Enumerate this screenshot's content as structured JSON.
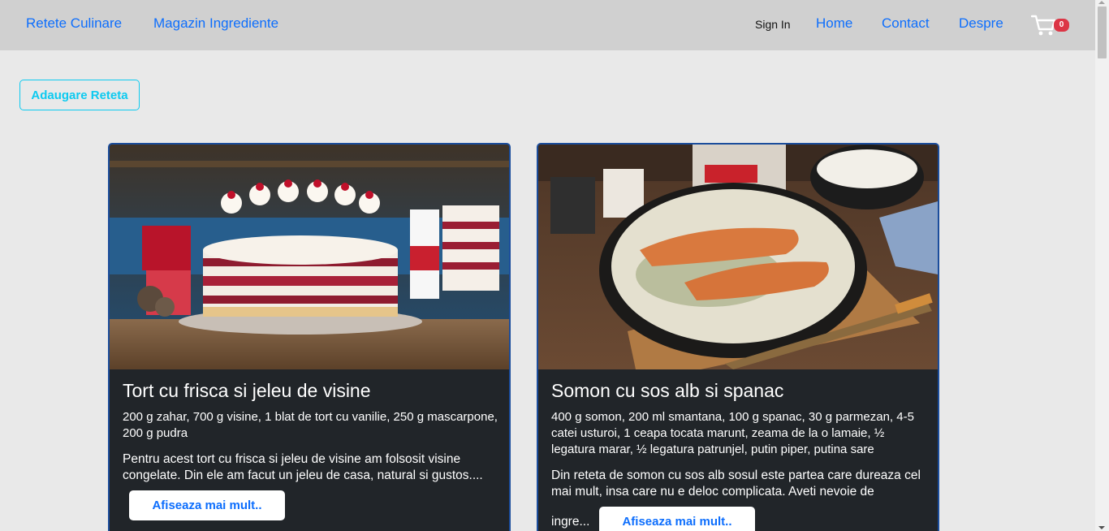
{
  "nav": {
    "brand_recipes": "Retete Culinare",
    "brand_store": "Magazin Ingrediente",
    "sign_in": "Sign In",
    "home": "Home",
    "contact": "Contact",
    "about": "Despre",
    "cart_count": "0"
  },
  "actions": {
    "add_recipe": "Adaugare Reteta"
  },
  "recipes": [
    {
      "title": "Tort cu frisca si jeleu de visine",
      "ingredients": "200 g zahar, 700 g visine, 1 blat de tort cu vanilie, 250 g mascarpone, 200 g pudra",
      "description": "Pentru acest tort cu frisca si jeleu de visine am folsosit visine congelate. Din ele am facut un jeleu de casa, natural si gustos....",
      "more_label": "Afiseaza mai mult.."
    },
    {
      "title": "Somon cu sos alb si spanac",
      "ingredients": "400 g somon, 200 ml smantana, 100 g spanac, 30 g parmezan, 4-5 catei usturoi, 1 ceapa tocata marunt, zeama de la o lamaie, ½ legatura marar, ½ legatura patrunjel, putin piper, putina sare",
      "description": "Din reteta de somon cu sos alb sosul este partea care dureaza cel mai mult, insa care nu e deloc complicata. Aveti nevoie de",
      "description_tail": "ingre...",
      "more_label": "Afiseaza mai mult.."
    }
  ],
  "colors": {
    "link": "#0d6efd",
    "accent_outline": "#0dcaf0",
    "card_bg": "#212529",
    "card_border": "#1b4d9c",
    "badge": "#dc3545"
  }
}
